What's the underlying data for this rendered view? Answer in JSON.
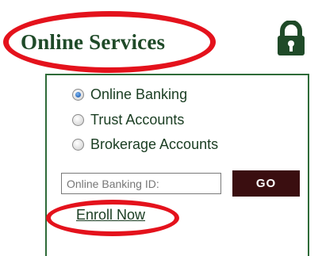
{
  "header": {
    "title": "Online Services",
    "lock_icon": "lock-icon",
    "accent_color": "#1f4a28",
    "highlight_color": "#e4121c"
  },
  "login": {
    "account_types": [
      {
        "label": "Online Banking",
        "selected": true
      },
      {
        "label": "Trust Accounts",
        "selected": false
      },
      {
        "label": "Brokerage Accounts",
        "selected": false
      }
    ],
    "id_placeholder": "Online Banking ID:",
    "id_value": "",
    "go_label": "GO",
    "go_color": "#3a0e10",
    "enroll_label": "Enroll Now"
  }
}
